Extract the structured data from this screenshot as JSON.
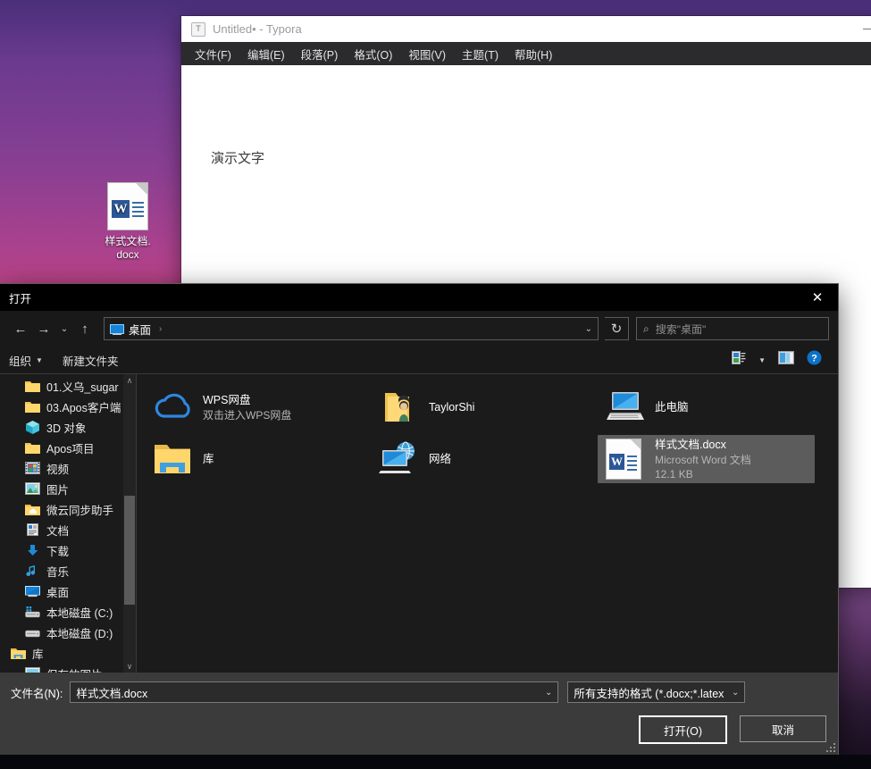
{
  "desktop": {
    "icon": {
      "label_line1": "样式文档.",
      "label_line2": "docx",
      "icon": "word-doc-icon",
      "letter": "W"
    }
  },
  "typora": {
    "title": "Untitled• - Typora",
    "logo_letter": "T",
    "minimize_icon": "minimize-icon",
    "menu": [
      {
        "label": "文件(F)"
      },
      {
        "label": "编辑(E)"
      },
      {
        "label": "段落(P)"
      },
      {
        "label": "格式(O)"
      },
      {
        "label": "视图(V)"
      },
      {
        "label": "主题(T)"
      },
      {
        "label": "帮助(H)"
      }
    ],
    "content": "演示文字"
  },
  "dialog": {
    "title": "打开",
    "close_icon": "close-icon",
    "nav": {
      "back_icon": "arrow-left-icon",
      "forward_icon": "arrow-right-icon",
      "recent_icon": "chevron-down-icon",
      "up_icon": "arrow-up-icon",
      "breadcrumb_icon": "desktop-icon",
      "breadcrumb": "桌面",
      "breadcrumb_separator": "›",
      "address_dropdown_icon": "chevron-down-icon",
      "refresh_icon": "refresh-icon"
    },
    "search": {
      "icon": "search-icon",
      "placeholder": "搜索\"桌面\""
    },
    "toolbar": {
      "organize": "组织",
      "organize_caret_icon": "chevron-down-icon",
      "new_folder": "新建文件夹",
      "view_icon": "view-options-icon",
      "view_caret_icon": "chevron-down-icon",
      "preview_pane_icon": "preview-pane-icon",
      "help_icon": "help-icon"
    },
    "sidebar": {
      "scroll_up_icon": "chevron-up-icon",
      "scroll_down_icon": "chevron-down-icon",
      "items": [
        {
          "label": "01.义乌_sugar",
          "icon": "folder-icon"
        },
        {
          "label": "03.Apos客户端",
          "icon": "folder-icon"
        },
        {
          "label": "3D 对象",
          "icon": "3d-objects-icon"
        },
        {
          "label": "Apos项目",
          "icon": "folder-icon"
        },
        {
          "label": "视频",
          "icon": "videos-icon"
        },
        {
          "label": "图片",
          "icon": "pictures-icon"
        },
        {
          "label": "微云同步助手",
          "icon": "weiyun-folder-icon"
        },
        {
          "label": "文档",
          "icon": "documents-icon"
        },
        {
          "label": "下载",
          "icon": "downloads-icon"
        },
        {
          "label": "音乐",
          "icon": "music-icon"
        },
        {
          "label": "桌面",
          "icon": "desktop-icon"
        },
        {
          "label": "本地磁盘 (C:)",
          "icon": "system-drive-icon"
        },
        {
          "label": "本地磁盘 (D:)",
          "icon": "drive-icon"
        },
        {
          "label": "库",
          "icon": "library-icon"
        },
        {
          "label": "保存的图片",
          "icon": "pictures-icon"
        }
      ]
    },
    "files": [
      {
        "name": "WPS网盘",
        "sub": "双击进入WPS网盘",
        "size": "",
        "icon": "cloud-icon",
        "selected": false
      },
      {
        "name": "TaylorShi",
        "sub": "",
        "size": "",
        "icon": "user-folder-icon",
        "selected": false
      },
      {
        "name": "此电脑",
        "sub": "",
        "size": "",
        "icon": "this-pc-icon",
        "selected": false
      },
      {
        "name": "库",
        "sub": "",
        "size": "",
        "icon": "library-icon",
        "selected": false
      },
      {
        "name": "网络",
        "sub": "",
        "size": "",
        "icon": "network-icon",
        "selected": false
      },
      {
        "name": "样式文档.docx",
        "sub": "Microsoft Word 文档",
        "size": "12.1 KB",
        "icon": "word-doc-icon",
        "selected": true
      }
    ],
    "footer": {
      "filename_label": "文件名(N):",
      "filename_value": "样式文档.docx",
      "filename_caret_icon": "chevron-down-icon",
      "filetype_value": "所有支持的格式 (*.docx;*.latex",
      "filetype_caret_icon": "chevron-down-icon",
      "open_button": "打开(O)",
      "cancel_button": "取消",
      "resize_grip_icon": "resize-grip-icon"
    }
  },
  "colors": {
    "accent": "#0078d7",
    "dialog_bg": "#1b1b1b",
    "selection": "#5c5c5c",
    "word_blue": "#2b5797"
  }
}
